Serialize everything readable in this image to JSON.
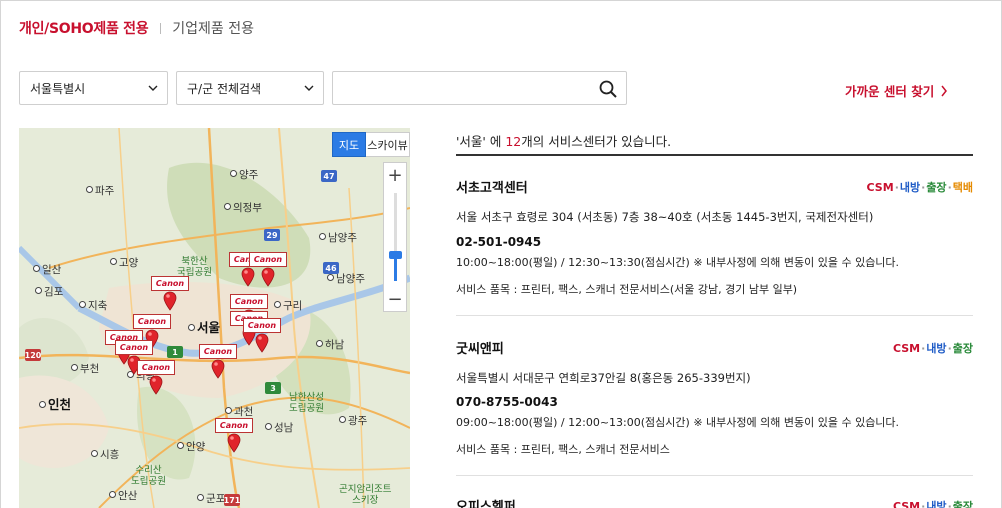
{
  "tabs": {
    "active": "개인/SOHO제품 전용",
    "inactive": "기업제품 전용"
  },
  "search": {
    "city": "서울특별시",
    "district": "구/군 전체검색",
    "keyword_value": "",
    "keyword_placeholder": "",
    "near_link": "가까운 센터 찾기"
  },
  "map": {
    "btn_map": "지도",
    "btn_sky": "스카이뷰",
    "zoom_in": "+",
    "zoom_out": "−",
    "zoom_level": 0.3,
    "marker_label": "Canon",
    "places": {
      "paju": "파주",
      "yangju": "양주",
      "uijeongbu": "의정부",
      "namyangju": "남양주",
      "goyang": "고양",
      "ilsan": "일산",
      "gimpo": "김포",
      "guri": "구리",
      "seoul": "서울",
      "hanam": "하남",
      "bucheon": "부천",
      "incheon": "인천",
      "gwacheon": "과천",
      "anyang": "안양",
      "siheung": "시흥",
      "gunpo": "군포",
      "seongnam": "성남",
      "gwangju": "광주",
      "ansan": "안산",
      "uiwang": "의왕",
      "jichuk": "지축"
    },
    "parks": {
      "bukhansan": "북한산\n국립공원",
      "namhansan": "남한산성\n도립공원",
      "surisan": "수리산\n도립공원",
      "gonjiam": "곤지암리조트\n스키장"
    },
    "roads": [
      "47",
      "29",
      "46",
      "120",
      "3",
      "171",
      "1"
    ]
  },
  "results": {
    "summary_prefix": "'서울' 에 ",
    "summary_count": "12",
    "summary_suffix": "개의 서비스센터가 있습니다.",
    "centers": [
      {
        "name": "서초고객센터",
        "tags": {
          "csm": "CSM",
          "visit": "내방",
          "trip": "출장",
          "parcel": "택배"
        },
        "address": "서울 서초구 효령로 304 (서초동) 7층 38~40호 (서초동 1445-3번지, 국제전자센터)",
        "phone": "02-501-0945",
        "hours": "10:00~18:00(평일) / 12:30~13:30(점심시간) ※ 내부사정에 의해 변동이 있을 수 있습니다.",
        "items": "서비스 품목 : 프린터, 팩스, 스캐너 전문서비스(서울 강남, 경기 남부 일부)"
      },
      {
        "name": "굿씨앤피",
        "tags": {
          "csm": "CSM",
          "visit": "내방",
          "trip": "출장"
        },
        "address": "서울특별시 서대문구 연희로37안길 8(홍은동 265-339번지)",
        "phone": "070-8755-0043",
        "hours": "09:00~18:00(평일) / 12:00~13:00(점심시간) ※ 내부사정에 의해 변동이 있을 수 있습니다.",
        "items": "서비스 품목 : 프린터, 팩스, 스캐너 전문서비스"
      },
      {
        "name": "오피스헬퍼",
        "tags": {
          "csm": "CSM",
          "visit": "내방",
          "trip": "출장"
        }
      }
    ]
  }
}
